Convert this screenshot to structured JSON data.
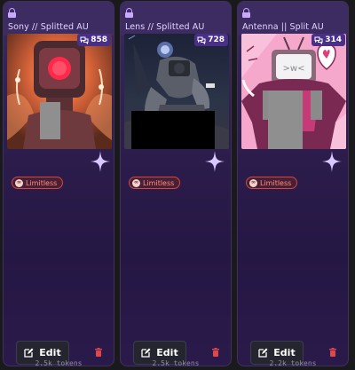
{
  "cards": [
    {
      "title": "Sony // Splitted AU",
      "chat_count": "858",
      "tag": "Limitless",
      "edit_label": "Edit",
      "tokens": "2.5k tokens"
    },
    {
      "title": "Lens // Splitted AU",
      "chat_count": "728",
      "tag": "Limitless",
      "edit_label": "Edit",
      "tokens": "2.5k tokens"
    },
    {
      "title": "Antenna || Split AU",
      "chat_count": "314",
      "tag": "Limitless",
      "edit_label": "Edit",
      "tokens": "2.2k tokens"
    }
  ],
  "icons": {
    "lock": "lock-icon",
    "chat": "chat-bubbles-icon",
    "sparkle": "sparkle-icon",
    "limitless": "infinity-icon",
    "edit": "edit-icon",
    "delete": "trash-icon"
  },
  "colors": {
    "accent": "#c8a9ff",
    "badge": "#4a2f88",
    "tag_border": "#d2483e",
    "tag_text": "#ff8d80",
    "delete": "#e0474c"
  }
}
